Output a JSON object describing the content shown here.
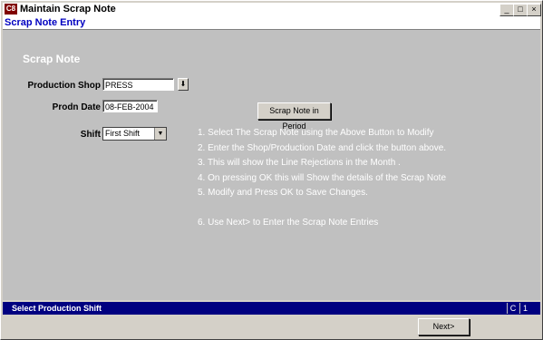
{
  "window": {
    "title": "Maintain Scrap Note",
    "app_icon_text": "C8",
    "minimize": "_",
    "maximize": "□",
    "close": "×"
  },
  "form": {
    "title": "Scrap Note Entry",
    "heading": "Scrap Note"
  },
  "fields": {
    "production_shop": {
      "label": "Production Shop",
      "value": "PRESS"
    },
    "prodn_date": {
      "label": "Prodn Date",
      "value": "08-FEB-2004"
    },
    "shift": {
      "label": "Shift",
      "value": "First Shift"
    }
  },
  "buttons": {
    "scrap_note_in_period": "Scrap Note in Period",
    "next": "Next>"
  },
  "instructions": [
    "1. Select The Scrap Note using the Above Button to Modify",
    "2. Enter the Shop/Production Date and click the button above.",
    "3. This will show the Line Rejections in the Month .",
    "4. On pressing OK this will Show the details of the Scrap Note",
    "5. Modify and Press OK to Save Changes.",
    "",
    "6. Use Next> to Enter the Scrap Note Entries"
  ],
  "status": {
    "message": "Select Production Shift",
    "mode": "C",
    "count": "1"
  }
}
